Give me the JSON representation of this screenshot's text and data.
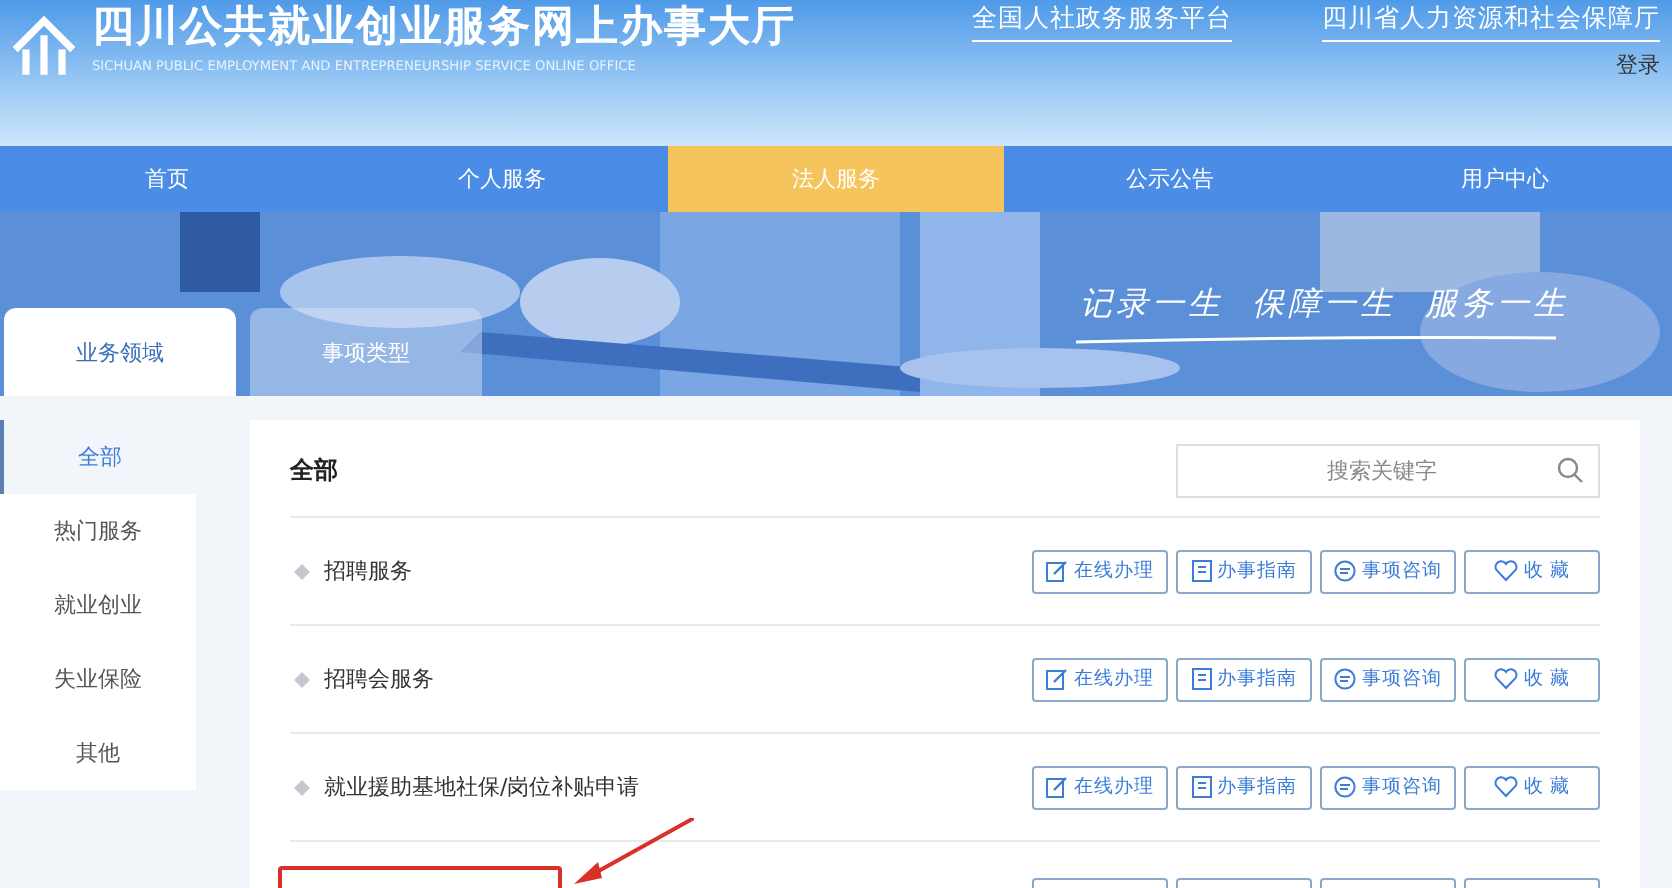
{
  "header": {
    "title": "四川公共就业创业服务网上办事大厅",
    "subtitle": "SICHUAN PUBLIC EMPLOYMENT AND ENTREPRENEURSHIP SERVICE ONLINE OFFICE",
    "links": [
      "全国人社政务服务平台",
      "四川省人力资源和社会保障厅"
    ],
    "login": "登录"
  },
  "nav": [
    {
      "label": "首页",
      "selected": false
    },
    {
      "label": "个人服务",
      "selected": false
    },
    {
      "label": "法人服务",
      "selected": true
    },
    {
      "label": "公示公告",
      "selected": false
    },
    {
      "label": "用户中心",
      "selected": false
    }
  ],
  "banner": {
    "slogan": "记录一生  保障一生  服务一生"
  },
  "tabs": [
    {
      "label": "业务领域",
      "selected": true
    },
    {
      "label": "事项类型",
      "selected": false
    }
  ],
  "sidebar": [
    {
      "label": "全部",
      "selected": true
    },
    {
      "label": "热门服务",
      "selected": false
    },
    {
      "label": "就业创业",
      "selected": false
    },
    {
      "label": "失业保险",
      "selected": false
    },
    {
      "label": "其他",
      "selected": false
    }
  ],
  "main": {
    "heading": "全部",
    "search": {
      "placeholder": "搜索关键字"
    },
    "rows": [
      {
        "kind": "item",
        "title": "招聘服务",
        "actions": [
          {
            "kind": "online",
            "label": "在线办理"
          },
          {
            "kind": "guide",
            "label": "办事指南"
          },
          {
            "kind": "consult",
            "label": "事项咨询"
          },
          {
            "kind": "favorite",
            "label": "收 藏"
          }
        ]
      },
      {
        "kind": "item",
        "title": "招聘会服务",
        "actions": [
          {
            "kind": "online",
            "label": "在线办理"
          },
          {
            "kind": "guide",
            "label": "办事指南"
          },
          {
            "kind": "consult",
            "label": "事项咨询"
          },
          {
            "kind": "favorite",
            "label": "收 藏"
          }
        ]
      },
      {
        "kind": "item",
        "title": "就业援助基地社保/岗位补贴申请",
        "actions": [
          {
            "kind": "online",
            "label": "在线办理"
          },
          {
            "kind": "guide",
            "label": "办事指南"
          },
          {
            "kind": "consult",
            "label": "事项咨询"
          },
          {
            "kind": "favorite",
            "label": "收 藏"
          }
        ]
      },
      {
        "kind": "annotated"
      }
    ]
  }
}
